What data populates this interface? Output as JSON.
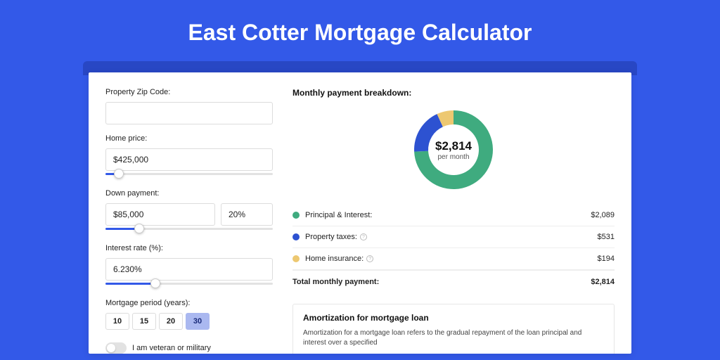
{
  "page": {
    "title": "East Cotter Mortgage Calculator"
  },
  "form": {
    "zip": {
      "label": "Property Zip Code:",
      "value": ""
    },
    "home_price": {
      "label": "Home price:",
      "value": "$425,000",
      "slider_pct": 8
    },
    "down_payment": {
      "label": "Down payment:",
      "amount": "$85,000",
      "percent": "20%",
      "slider_pct": 20
    },
    "interest": {
      "label": "Interest rate (%):",
      "value": "6.230%",
      "slider_pct": 30
    },
    "period": {
      "label": "Mortgage period (years):",
      "options": [
        "10",
        "15",
        "20",
        "30"
      ],
      "selected": "30"
    },
    "veteran": {
      "label": "I am veteran or military",
      "value": false
    }
  },
  "breakdown": {
    "title": "Monthly payment breakdown:",
    "center_amount": "$2,814",
    "center_sub": "per month",
    "items": [
      {
        "label": "Principal & Interest:",
        "value": "$2,089",
        "color": "#3fab7f",
        "help": false
      },
      {
        "label": "Property taxes:",
        "value": "$531",
        "color": "#2d52d1",
        "help": true
      },
      {
        "label": "Home insurance:",
        "value": "$194",
        "color": "#edc871",
        "help": true
      }
    ],
    "total_label": "Total monthly payment:",
    "total_value": "$2,814"
  },
  "chart_data": {
    "type": "pie",
    "title": "Monthly payment breakdown",
    "series": [
      {
        "name": "Principal & Interest",
        "value": 2089,
        "color": "#3fab7f"
      },
      {
        "name": "Property taxes",
        "value": 531,
        "color": "#2d52d1"
      },
      {
        "name": "Home insurance",
        "value": 194,
        "color": "#edc871"
      }
    ],
    "total": 2814,
    "center_label": "$2,814 per month"
  },
  "amort": {
    "title": "Amortization for mortgage loan",
    "text": "Amortization for a mortgage loan refers to the gradual repayment of the loan principal and interest over a specified"
  }
}
